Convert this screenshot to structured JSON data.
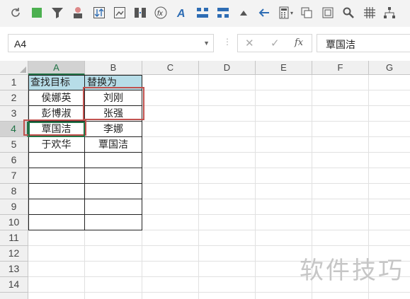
{
  "toolbar": {
    "icons": [
      "refresh-icon",
      "fill-color-icon",
      "filter-icon",
      "person-icon",
      "sort-icon",
      "image-icon",
      "column-icon",
      "function-icon",
      "font-color-icon",
      "merge-icon",
      "split-icon",
      "triangle-up-icon",
      "arrow-left-icon",
      "calculator-icon",
      "copy-icon",
      "frame-icon",
      "search-icon",
      "grid-icon",
      "tree-icon"
    ],
    "function_label": "fx"
  },
  "formula_bar": {
    "name_box": "A4",
    "cancel": "✕",
    "confirm": "✓",
    "fx": "fx",
    "value": "覃国洁"
  },
  "columns": [
    "A",
    "B",
    "C",
    "D",
    "E",
    "F",
    "G"
  ],
  "rows": [
    "1",
    "2",
    "3",
    "4",
    "5",
    "6",
    "7",
    "8",
    "9",
    "10",
    "11",
    "12",
    "13",
    "14"
  ],
  "table": {
    "header": [
      "查找目标",
      "替换为"
    ],
    "col_a": [
      "侯娜英",
      "彭博淑",
      "覃国洁",
      "于欢华"
    ],
    "col_b": [
      "刘刚",
      "张强",
      "李娜",
      "覃国洁"
    ]
  },
  "selected_cell": "A4",
  "colors": {
    "header_fill": "#b7dde8",
    "highlight_border": "#c0504d",
    "select_accent": "#217346"
  },
  "watermark": "软件技巧"
}
